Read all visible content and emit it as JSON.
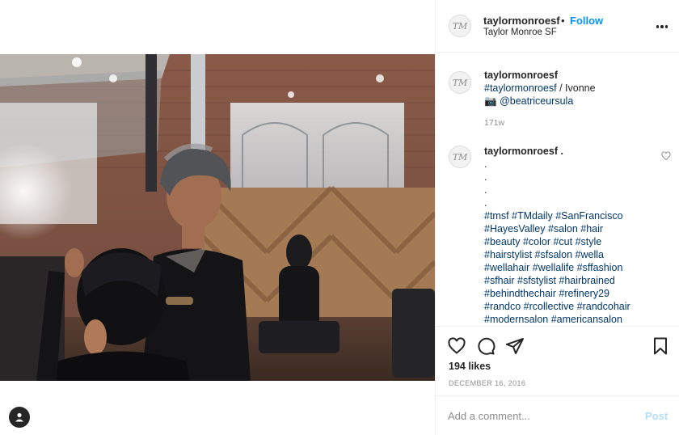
{
  "header": {
    "avatar_monogram": "TM",
    "username": "taylormonroesf",
    "separator": "•",
    "follow_label": "Follow",
    "location": "Taylor Monroe SF"
  },
  "caption": {
    "username": "taylormonroesf",
    "hashtag": "#taylormonroesf",
    "line1_rest": " / Ivonne",
    "camera_emoji": "📷",
    "mention": "@beatriceursula",
    "time_ago": "171w"
  },
  "comment": {
    "username": "taylormonroesf",
    "first_char": ".",
    "dots": [
      ".",
      ".",
      ".",
      "."
    ],
    "hashtag_lines": [
      "#tmsf #TMdaily #SanFrancisco",
      "#HayesValley #salon #hair",
      "#beauty #color #cut #style",
      "#hairstylist #sfsalon #wella",
      "#wellahair #wellalife #sffashion",
      "#sfhair #sfstylist #hairbrained",
      "#behindthechair #refinery29",
      "#randco #rcollective #randcohair",
      "#modernsalon #americansalon"
    ]
  },
  "actions": {
    "like_icon": "heart-icon",
    "comment_icon": "comment-icon",
    "share_icon": "share-icon",
    "save_icon": "bookmark-icon",
    "likes": "194 likes",
    "date": "DECEMBER 16, 2016"
  },
  "add_comment": {
    "placeholder": "Add a comment...",
    "post_label": "Post"
  },
  "colors": {
    "link": "#00376b",
    "follow": "#0095f6",
    "post_disabled": "#b2dffc",
    "muted": "#8e8e8e",
    "border": "#efefef"
  }
}
